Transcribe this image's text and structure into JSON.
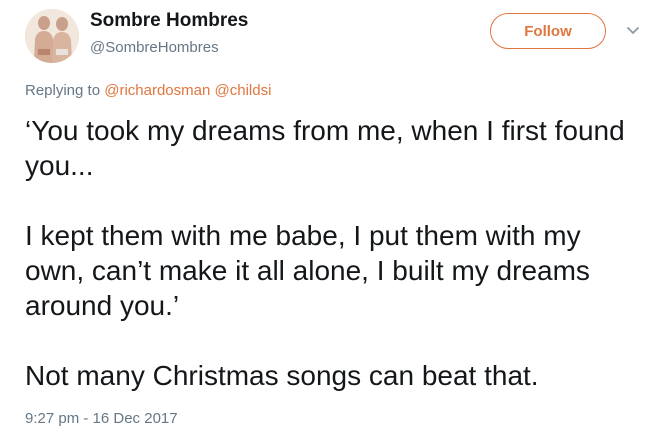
{
  "user": {
    "display_name": "Sombre Hombres",
    "handle": "@SombreHombres",
    "avatar_icon": "profile-photo-two-people"
  },
  "follow_button": {
    "label": "Follow"
  },
  "menu": {
    "caret_icon": "chevron-down-icon"
  },
  "reply": {
    "prefix": "Replying to",
    "mentions": [
      "@richardosman",
      "@childsi"
    ]
  },
  "tweet": {
    "paragraphs": [
      "‘You took my dreams from me, when I first found you...",
      "I kept them with me babe, I put them with my own, can’t make it all alone, I built my dreams around you.’",
      "Not many Christmas songs can beat that."
    ],
    "timestamp": "9:27 pm - 16 Dec 2017"
  },
  "colors": {
    "accent": "#e0763f",
    "text": "#14171a",
    "secondary": "#657786"
  }
}
